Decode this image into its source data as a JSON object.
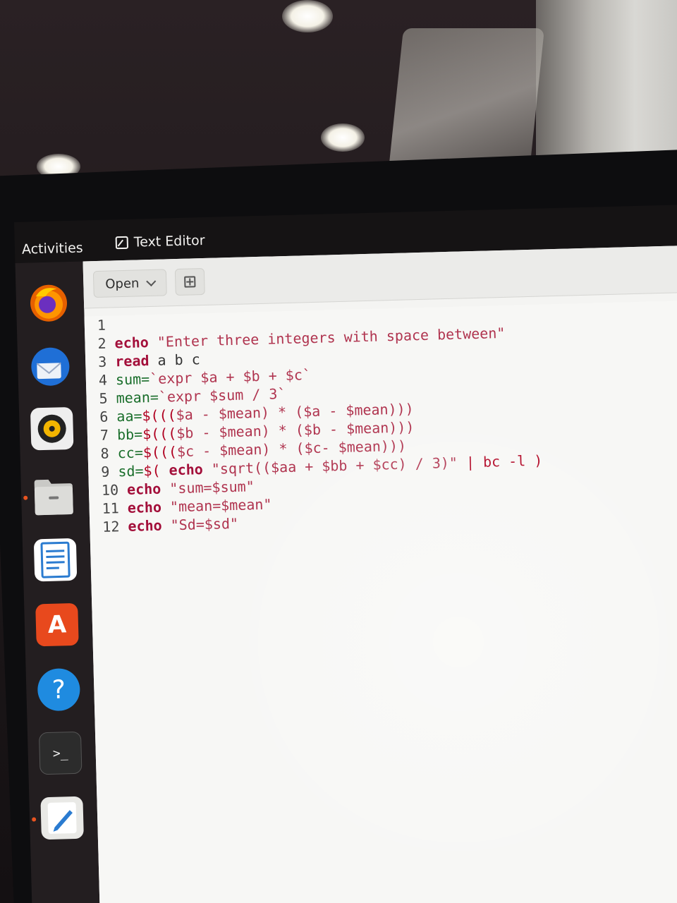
{
  "topbar": {
    "activities_label": "Activities",
    "app_menu_label": "Text Editor"
  },
  "dock": {
    "items": [
      {
        "name": "firefox",
        "icon": "firefox-icon"
      },
      {
        "name": "thunderbird",
        "icon": "thunderbird-icon"
      },
      {
        "name": "rhythmbox",
        "icon": "rhythmbox-icon"
      },
      {
        "name": "files",
        "icon": "files-icon"
      },
      {
        "name": "libreoffice-writer",
        "icon": "writer-icon"
      },
      {
        "name": "software",
        "icon": "software-icon",
        "glyph": "A"
      },
      {
        "name": "help",
        "icon": "help-icon",
        "glyph": "?"
      },
      {
        "name": "terminal",
        "icon": "terminal-icon",
        "glyph": ">_"
      },
      {
        "name": "text-editor",
        "icon": "text-editor-icon"
      }
    ]
  },
  "editor": {
    "open_label": "Open",
    "lines": [
      {
        "n": "1",
        "parts": []
      },
      {
        "n": "2",
        "parts": [
          [
            "kw",
            "echo"
          ],
          [
            "plain",
            " "
          ],
          [
            "str",
            "\"Enter three integers with space between\""
          ]
        ]
      },
      {
        "n": "3",
        "parts": [
          [
            "kw",
            "read"
          ],
          [
            "plain",
            " a b c"
          ]
        ]
      },
      {
        "n": "4",
        "parts": [
          [
            "var",
            "sum="
          ],
          [
            "str",
            "`expr $a + $b + $c`"
          ]
        ]
      },
      {
        "n": "5",
        "parts": [
          [
            "var",
            "mean="
          ],
          [
            "str",
            "`expr $sum / 3`"
          ]
        ]
      },
      {
        "n": "6",
        "parts": [
          [
            "var",
            "aa="
          ],
          [
            "op",
            "$((("
          ],
          [
            "str",
            "$a - $mean) * ($a - $mean)))"
          ]
        ]
      },
      {
        "n": "7",
        "parts": [
          [
            "var",
            "bb="
          ],
          [
            "op",
            "$((("
          ],
          [
            "str",
            "$b - $mean) * ($b - $mean)))"
          ]
        ]
      },
      {
        "n": "8",
        "parts": [
          [
            "var",
            "cc="
          ],
          [
            "op",
            "$((("
          ],
          [
            "str",
            "$c - $mean) * ($c- $mean)))"
          ]
        ]
      },
      {
        "n": "9",
        "parts": [
          [
            "var",
            "sd="
          ],
          [
            "op",
            "$( "
          ],
          [
            "kw",
            "echo"
          ],
          [
            "plain",
            " "
          ],
          [
            "str",
            "\"sqrt(($aa + $bb + $cc) / 3)\""
          ],
          [
            "op",
            " | bc -l )"
          ]
        ]
      },
      {
        "n": "10",
        "parts": [
          [
            "kw",
            "echo"
          ],
          [
            "plain",
            " "
          ],
          [
            "str",
            "\"sum=$sum\""
          ]
        ]
      },
      {
        "n": "11",
        "parts": [
          [
            "kw",
            "echo"
          ],
          [
            "plain",
            " "
          ],
          [
            "str",
            "\"mean=$mean\""
          ]
        ]
      },
      {
        "n": "12",
        "parts": [
          [
            "kw",
            "echo"
          ],
          [
            "plain",
            " "
          ],
          [
            "str",
            "\"Sd=$sd\""
          ]
        ]
      }
    ]
  }
}
